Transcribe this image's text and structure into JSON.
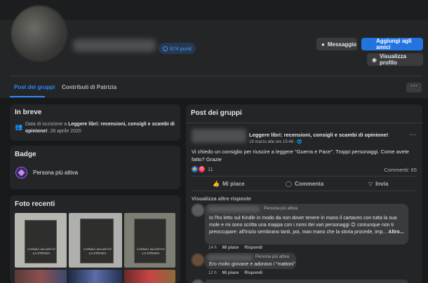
{
  "profile": {
    "points": "674 punti"
  },
  "header": {
    "message_label": "Messaggio",
    "add_friend_label": "Aggiungi agli amici",
    "view_profile_label": "Visualizza profilo"
  },
  "tabs": [
    {
      "label": "Post dei gruppi"
    },
    {
      "label": "Contributi di Patrizia"
    }
  ],
  "more_label": "···",
  "intro": {
    "title": "In breve",
    "line_prefix": "Data di iscrizione a ",
    "group_name": "Leggere libri: recensioni, consigli e scambi di opinione!",
    "date": ": 28 aprile 2020"
  },
  "badge": {
    "title": "Badge",
    "label": "Persona più attiva"
  },
  "photos": {
    "title": "Foto recenti",
    "book_author": "CORMAC McCARTHY",
    "book_title": "LA STRADA"
  },
  "feed": {
    "title": "Post dei gruppi",
    "post": {
      "group_name": "Leggere libri: recensioni, consigli e scambi di opinione!",
      "time": "19 marzo alle ore 15:48 · ",
      "more": "···",
      "text": "Vi chiedo un consiglio per riuscire a leggere \"Guerra e Pace\". Troppi personaggi. Come avete fatto? Grazie",
      "reactions_count": "11",
      "comments_count": "Commenti: 65",
      "like_label": "Mi piace",
      "comment_label": "Commenta",
      "share_label": "Invia",
      "view_more_replies": "Visualizza altre risposte"
    },
    "comments": [
      {
        "badge": "Persona più attiva",
        "text": "Io l'ho letto sul Kindle in modo da non dover tenere in mano il cartaceo con tutta la sua mole e mi sono scritta una mappa con i nomi dei vari personaggi 😉 comunque non ti preoccupare: all'inizio sembrano tanti, poi, man mano che la storia procede, imp...",
        "more": "Altro...",
        "time": "14 h",
        "like": "Mi piace",
        "reply": "Rispondi"
      },
      {
        "badge": "Persona più attiva",
        "text": "Ero molto giovane e adoravo i \"mattoni\"",
        "time": "12 h",
        "like": "Mi piace",
        "reply": "Rispondi"
      }
    ]
  },
  "colors": {
    "accent": "#2d88ff",
    "button_blue": "#2374e1",
    "card_bg": "#242526",
    "page_bg": "#18191a"
  }
}
